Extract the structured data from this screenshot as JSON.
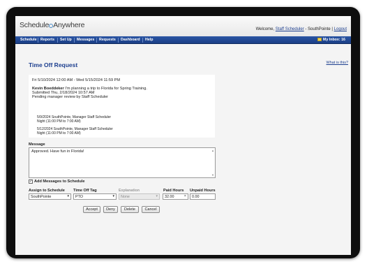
{
  "header": {
    "logo_text": "Schedule",
    "logo_text_2": "Anywhere",
    "welcome_prefix": "Welcome, ",
    "user_name": "Staff Scheduler",
    "location_sep": " - SouthPointe | ",
    "logout_label": "Logout"
  },
  "nav": {
    "items": [
      "Schedule",
      "Reports",
      "Set Up",
      "Messages",
      "Requests",
      "Dashboard",
      "Help"
    ],
    "inbox_label": "My Inbox: 16"
  },
  "page": {
    "title": "Time Off Request",
    "what_is_this": "What is this?"
  },
  "request": {
    "date_range": "Fri 5/10/2024 12:00 AM - Wed 5/15/2024 11:59 PM",
    "requester": "Kevin Boeddeker",
    "note": " I'm planning a trip to Florida for Spring Training.",
    "submitted": "Submitted Thu, 2/18/2024 10:57 AM",
    "status": "Pending manager review by Staff Scheduler",
    "shifts": [
      {
        "line1": "5/9/2024 SouthPointe, Manager Staff Scheduler",
        "line2": "Night (11:00 PM to 7:00 AM)"
      },
      {
        "line1": "5/12/2024 SouthPointe, Manager Staff Scheduler",
        "line2": "Night (11:00 PM to 7:00 AM)"
      }
    ]
  },
  "message": {
    "label": "Message",
    "value": "Approved. Have fun in Florida!"
  },
  "add_messages": {
    "label": "Add Messages to Schedule",
    "checked": "✓"
  },
  "fields": {
    "assign_label": "Assign to Schedule",
    "assign_value": "SouthPointe",
    "tag_label": "Time Off Tag",
    "tag_value": "PTO",
    "explanation_label": "Explanation",
    "explanation_value": "None",
    "paid_label": "Paid Hours",
    "paid_value": "32.00",
    "unpaid_label": "Unpaid Hours",
    "unpaid_value": "0.00"
  },
  "buttons": {
    "accept": "Accept",
    "deny": "Deny",
    "delete": "Delete",
    "cancel": "Cancel"
  },
  "colors": {
    "nav_bg": "#1b3f86",
    "title": "#1d3f8f",
    "device": "#0e0e0e"
  }
}
